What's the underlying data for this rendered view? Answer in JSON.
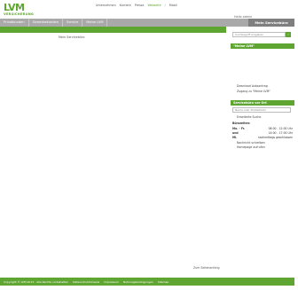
{
  "brand": {
    "name": "LVM",
    "sub": "VERSICHERUNG"
  },
  "top_links": [
    {
      "label": "Unternehmen",
      "active": false
    },
    {
      "label": "Karriere",
      "active": false
    },
    {
      "label": "Presse",
      "active": false
    },
    {
      "label": "Webseite",
      "active": true
    },
    {
      "label": "Mobil",
      "active": false
    }
  ],
  "top_links_separator": "/",
  "nav": {
    "items": [
      "Privatkunden",
      "Gewerbekunden",
      "Service",
      "Meine LVM"
    ],
    "active": "Mein Servicebüro"
  },
  "breadcrumb": "Mein Servicebüro",
  "right": {
    "greeting": "Hallo admin",
    "search_placeholder": "Suchbegriff eingeben",
    "search_icon": "chevron-right-icon",
    "meine_lvm_title": "\"Meine LVM\"",
    "download_link": "Download Autoantrag",
    "zugang_link": "Zugang zu \"Meine LVM\"",
    "servicebuero_title": "Servicebüro vor Ort",
    "plz_placeholder": "Name oder Postleitzahl",
    "erweiterte_suche": "Erweiterte Suche",
    "hours_title": "Bürozeiten:",
    "hours_rows": [
      {
        "label": "Mo. - Fr.",
        "value": "08:00 - 12:00 Uhr"
      },
      {
        "label": "und",
        "value": "14:00 - 17:00 Uhr"
      },
      {
        "label": "Mi.",
        "value": "nachmittags geschlossen"
      }
    ],
    "nachricht": "Nachricht schreiben",
    "homepage": "Homepage aufrufen"
  },
  "sitemap_link": "Zum Seitenanfang",
  "footer": {
    "copyright": "Copyright © LVM 2013 - Alle Rechte vorbehalten",
    "links": [
      "Datenschutzhinweis",
      "Impressum",
      "Nutzungsbedingungen",
      "Sitemap"
    ]
  },
  "colors": {
    "brand_green": "#5fa532",
    "nav_gray": "#a9a9a9",
    "nav_active": "#7f7f7f"
  }
}
